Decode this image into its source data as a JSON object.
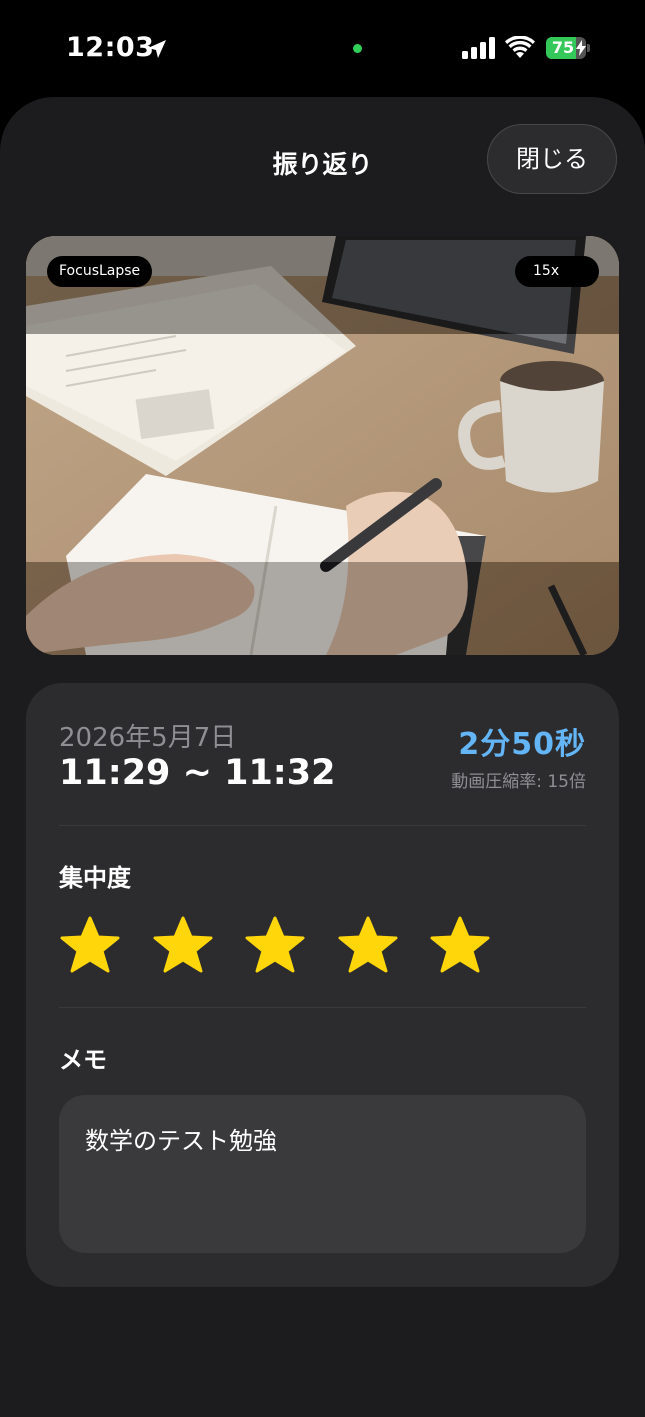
{
  "status_bar": {
    "time": "12:03",
    "battery_percent": 75,
    "battery_text": "75"
  },
  "header": {
    "title": "振り返り",
    "close_label": "閉じる"
  },
  "preview": {
    "app_badge": "FocusLapse",
    "speed_badge": "15x"
  },
  "session": {
    "date": "2026年5月7日",
    "time_range": "11:29 ~ 11:32",
    "duration": "2分50秒",
    "compression": "動画圧縮率: 15倍"
  },
  "focus": {
    "label": "集中度",
    "rating": 5,
    "max_rating": 5
  },
  "memo": {
    "label": "メモ",
    "text": "数学のテスト勉強"
  },
  "colors": {
    "accent": "#64b5f6",
    "star": "#ffd60a",
    "sheet_bg": "#1c1c1e",
    "card_bg": "#2c2c2e"
  }
}
